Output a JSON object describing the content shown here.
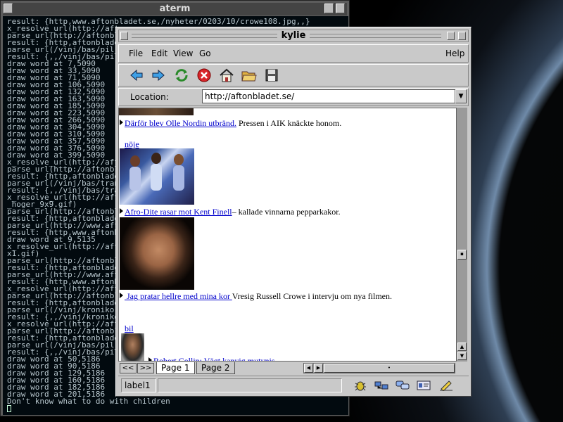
{
  "aterm": {
    "title": "aterm",
    "lines": [
      "result: {http,www.aftonbladet.se,/nyheter/0203/10/crowe108.jpg,,}",
      "x_resolve_url(http://afto",
      "parse_url(http://aftonbla",
      "result: {http,aftonbladet",
      "parse_url(/vinj/bas/pil_s",
      "result: {,,/vinj/bas/pil_",
      "draw word at 7,5090",
      "draw word at 33,5090",
      "draw word at 71,5090",
      "draw word at 106,5090",
      "draw word at 132,5090",
      "draw word at 163,5090",
      "draw word at 185,5090",
      "draw word at 223,5090",
      "draw word at 266,5090",
      "draw word at 304,5090",
      "draw word at 310,5090",
      "draw word at 357,5090",
      "draw word at 376,5090",
      "draw word at 399,5090",
      "x_resolve_url(http://afto",
      "parse_url(http://aftonbla",
      "result: {http,aftonbladet",
      "parse_url(/vinj/bas/trans",
      "result: {,,/vinj/bas/trans",
      "x_resolve_url(http://afto",
      "_hoger_9x9.gif)",
      "parse_url(http://aftonbla",
      "result: {http,aftonbladet",
      "parse_url(http://www.afto",
      "result: {http,www.aftonbla",
      "draw word at 9,5135",
      "x_resolve_url(http://afto",
      "x1.gif)",
      "parse_url(http://aftonbla",
      "result: {http,aftonbladet",
      "parse_url(http://www.afto",
      "result: {http,www.aftonbla",
      "x_resolve_url(http://afto",
      "parse_url(http://aftonbla",
      "result: {http,aftonbladet",
      "parse_url(/vinj/kronikore",
      "result: {,,/vinj/kronikore",
      "x_resolve_url(http://afto",
      "parse_url(http://aftonbla",
      "result: {http,aftonbladet",
      "parse_url(/vinj/bas/pil_s",
      "result: {,,/vinj/bas/pil_",
      "draw word at 50,5186",
      "draw word at 90,5186",
      "draw word at 129,5186",
      "draw word at 160,5186",
      "draw word at 182,5186",
      "draw word at 201,5186",
      "Don't know what to do with children"
    ]
  },
  "kylie": {
    "title": "kylie",
    "menu": {
      "file": "File",
      "edit": "Edit",
      "view": "View",
      "go": "Go",
      "help": "Help"
    },
    "location_label": "Location:",
    "location_value": "http://aftonbladet.se/",
    "content": {
      "item1_link": "Därför blev Olle Nordin utbränd.",
      "item1_text": " Pressen i AIK knäckte honom.",
      "section2": "nöje",
      "item2_link": "Afro-Dite rasar mot Kent Finell",
      "item2_text": "– kallade vinnarna pepparkakor.",
      "item3_link": " Jag pratar hellre med mina kor ",
      "item3_text": "Vresig Russell Crowe i intervju om nya filmen.",
      "section3": "bil",
      "item4_link": "Robert Collin: Vägt kanyig mutynis"
    },
    "tabs": {
      "prev": "<<",
      "next": ">>",
      "page1": "Page 1",
      "page2": "Page 2"
    },
    "status_label": "label1"
  },
  "colors": {
    "link": "#0000cc",
    "chrome": "#c9c9c9",
    "terminal_bg": "#020a0f"
  }
}
